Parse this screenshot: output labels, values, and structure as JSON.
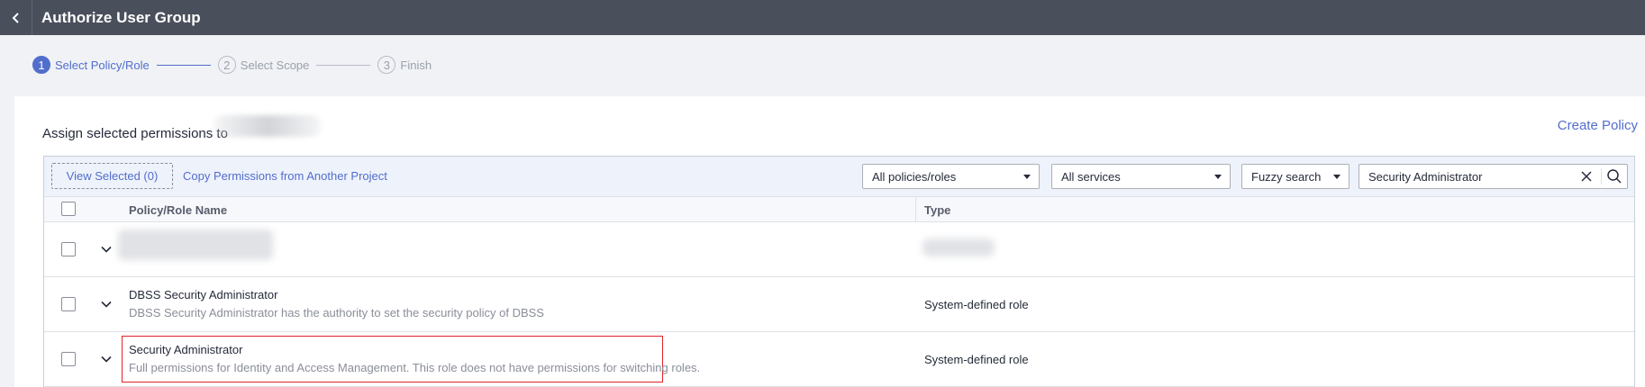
{
  "header": {
    "title": "Authorize User Group"
  },
  "steps": [
    {
      "number": "1",
      "label": "Select Policy/Role",
      "state": "active"
    },
    {
      "number": "2",
      "label": "Select Scope",
      "state": "pending"
    },
    {
      "number": "3",
      "label": "Finish",
      "state": "pending"
    }
  ],
  "main": {
    "assign_text": "Assign selected permissions to",
    "create_policy_label": "Create Policy"
  },
  "toolbar": {
    "view_selected_label": "View Selected (0)",
    "copy_permissions_label": "Copy Permissions from Another Project",
    "policy_filter_value": "All policies/roles",
    "service_filter_value": "All services",
    "search_mode_value": "Fuzzy search",
    "search_value": "Security Administrator"
  },
  "table": {
    "columns": [
      "Policy/Role Name",
      "Type"
    ],
    "rows": [
      {
        "name": "",
        "description": "",
        "type": "",
        "blurred": true
      },
      {
        "name": "DBSS Security Administrator",
        "description": "DBSS Security Administrator has the authority to set the security policy of DBSS",
        "type": "System-defined role"
      },
      {
        "name": "Security Administrator",
        "description": "Full permissions for Identity and Access Management. This role does not have permissions for switching roles.",
        "type": "System-defined role",
        "highlighted": true
      }
    ]
  },
  "colors": {
    "topbar": "#4a4f5c",
    "accent": "#526ecc",
    "highlight": "#e0222a"
  },
  "icons": {
    "back": "chevron-left-icon",
    "expand": "chevron-down-icon",
    "dropdown": "caret-down-icon",
    "clear": "close-icon",
    "search": "search-icon"
  }
}
